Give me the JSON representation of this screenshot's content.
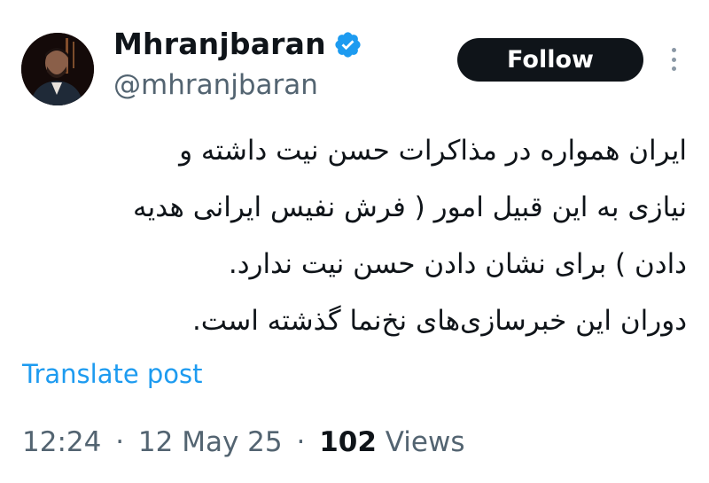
{
  "author": {
    "display_name": "Mhranjbaran",
    "handle": "@mhranjbaran",
    "verified_icon": "verified-badge-icon",
    "verified_color": "#1d9bf0"
  },
  "follow_button": {
    "label": "Follow",
    "background": "#0f1419",
    "text_color": "#ffffff"
  },
  "more_menu": {
    "icon": "more-vertical-icon"
  },
  "tweet": {
    "lines": [
      "ایران همواره در مذاکرات حسن نیت داشته و",
      "نیازی به این قبیل امور ( فرش نفیس ایرانی هدیه",
      "دادن ) برای نشان دادن حسن نیت ندارد.",
      "دوران این خبرسازی‌های نخ‌نما گذشته است."
    ]
  },
  "translate": {
    "label": "Translate post",
    "color": "#1d9bf0"
  },
  "meta": {
    "time": "12:24",
    "separator": "·",
    "date": "12 May 25",
    "views_count": "102",
    "views_label": "Views"
  }
}
